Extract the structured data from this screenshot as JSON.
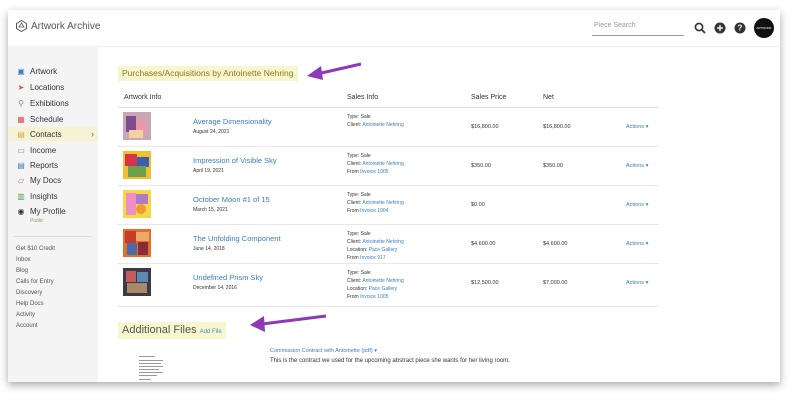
{
  "app": {
    "name": "Artwork Archive"
  },
  "topbar": {
    "search_placeholder": "Piece Search",
    "avatar_label": "ARTWORK ARCHIVE"
  },
  "sidebar": {
    "items": [
      {
        "label": "Artwork",
        "icon": "image-icon",
        "color": "#3b7cc0"
      },
      {
        "label": "Locations",
        "icon": "location-arrow-icon",
        "color": "#d9534f"
      },
      {
        "label": "Exhibitions",
        "icon": "map-pin-icon",
        "color": "#5aa05a"
      },
      {
        "label": "Schedule",
        "icon": "calendar-icon",
        "color": "#d9534f"
      },
      {
        "label": "Contacts",
        "icon": "address-book-icon",
        "color": "#d9a640"
      },
      {
        "label": "Income",
        "icon": "money-icon",
        "color": "#5aa05a"
      },
      {
        "label": "Reports",
        "icon": "report-icon",
        "color": "#3b7cc0"
      },
      {
        "label": "My Docs",
        "icon": "folder-icon",
        "color": "#d9534f"
      },
      {
        "label": "Insights",
        "icon": "bar-chart-icon",
        "color": "#5aa05a"
      },
      {
        "label": "My Profile",
        "icon": "globe-icon",
        "color": "#333333"
      }
    ],
    "active_index": 4,
    "profile_status": "Public",
    "links": [
      "Get $10 Credit",
      "Inbox",
      "Blog",
      "Calls for Entry",
      "Discovery",
      "Help Docs",
      "Activity",
      "Account"
    ]
  },
  "main": {
    "heading": "Purchases/Acquisitions by Antoinette Nehring",
    "columns": [
      "Artwork Info",
      "Sales Info",
      "Sales Price",
      "Net"
    ],
    "rows": [
      {
        "title": "Average Dimensionality",
        "date": "August 24, 2021",
        "type": "Type: Sale",
        "client_label": "Client:",
        "client": "Antoinette Nehring",
        "location_label": "",
        "location": "",
        "from_label": "",
        "from": "",
        "price": "$16,800.00",
        "net": "$16,800.00",
        "actions": "Actions ▾"
      },
      {
        "title": "Impression of Visible Sky",
        "date": "April 19, 2021",
        "type": "Type: Sale",
        "client_label": "Client:",
        "client": "Antoinette Nehring",
        "location_label": "",
        "location": "",
        "from_label": "From",
        "from": "Invoice 1005",
        "price": "$350.00",
        "net": "$350.00",
        "actions": "Actions ▾"
      },
      {
        "title": "October Moon #1 of 15",
        "date": "March 15, 2021",
        "type": "Type: Sale",
        "client_label": "Client:",
        "client": "Antoinette Nehring",
        "location_label": "",
        "location": "",
        "from_label": "From",
        "from": "Invoice 1004",
        "price": "$0.00",
        "net": "",
        "actions": "Actions ▾"
      },
      {
        "title": "The Unfolding Component",
        "date": "June 14, 2018",
        "type": "Type: Sale",
        "client_label": "Client:",
        "client": "Antoinette Nehring",
        "location_label": "Location:",
        "location": "Pace Gallery",
        "from_label": "From",
        "from": "Invoice 917",
        "price": "$4,600.00",
        "net": "$4,600.00",
        "actions": "Actions ▾"
      },
      {
        "title": "Undefined Prism Sky",
        "date": "December 14, 2016",
        "type": "Type: Sale",
        "client_label": "Client:",
        "client": "Antoinette Nehring",
        "location_label": "Location:",
        "location": "Pace Gallery",
        "from_label": "From",
        "from": "Invoice 1005",
        "price": "$12,500.00",
        "net": "$7,000.00",
        "actions": "Actions ▾"
      }
    ],
    "files_heading": "Additional Files",
    "add_file_label": "Add File",
    "file": {
      "name": "Commission Contract with Antoinette (pdf) ▾",
      "description": "This is the contract we used for the upcoming abstract piece she wants for her living room."
    }
  },
  "colors": {
    "highlight": "#f8f6cc",
    "link": "#3b7cc0",
    "arrow": "#8e3ab8"
  }
}
